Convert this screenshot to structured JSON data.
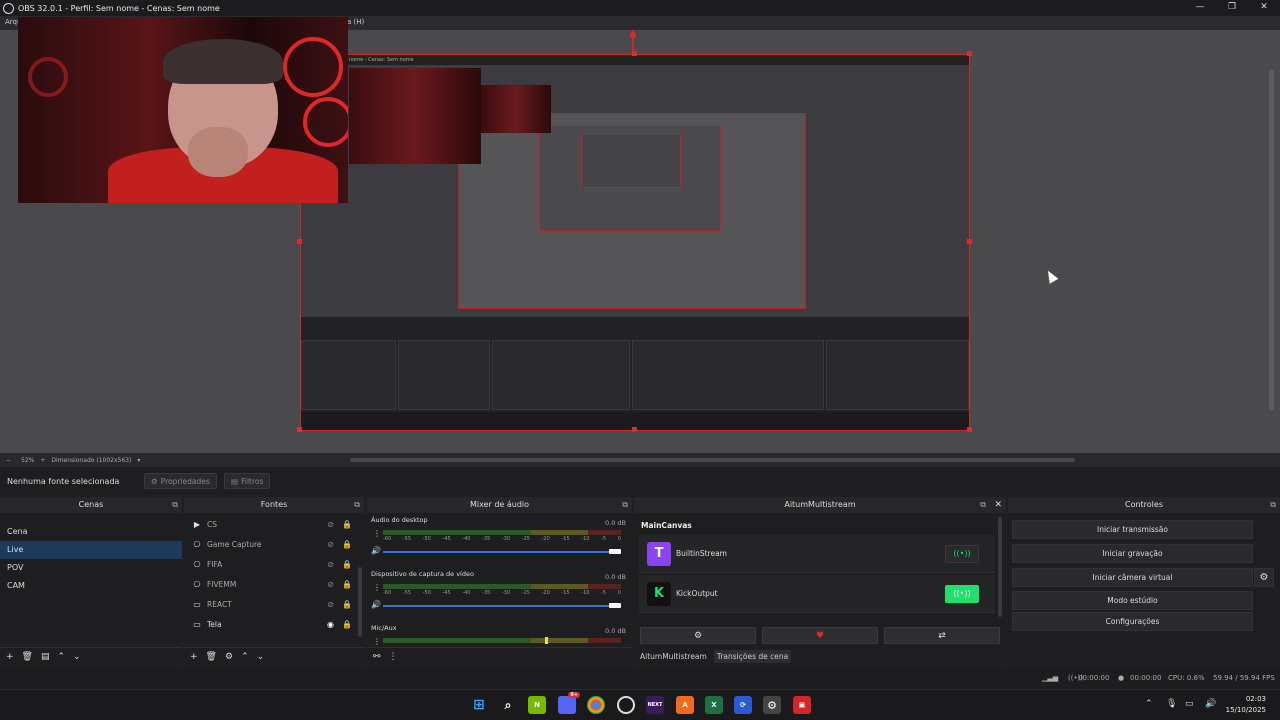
{
  "window": {
    "title": "OBS 32.0.1 - Perfil: Sem nome - Cenas: Sem nome",
    "minimize": "—",
    "maximize": "❐",
    "close": "✕"
  },
  "menubar": {
    "left_fragment": "Arqu",
    "right_fragment": "a (H)"
  },
  "preview": {
    "inner_title": "nome - Cenas: Sem nome"
  },
  "zoombar": {
    "minus": "−",
    "zoom": "52%",
    "plus": "+",
    "mode": "Dimensionado (1002x563)",
    "dropdown": "▾"
  },
  "sourcebar": {
    "no_source": "Nenhuma fonte selecionada",
    "properties": "Propriedades",
    "filters": "Filtros"
  },
  "scenes": {
    "header": "Cenas",
    "items": [
      "Cena",
      "Live",
      "POV",
      "CAM"
    ],
    "selected": "Live"
  },
  "sources": {
    "header": "Fontes",
    "items": [
      {
        "label": "CS",
        "icon": "play-icon"
      },
      {
        "label": "Game Capture",
        "icon": "gamepad-icon"
      },
      {
        "label": "FIFA",
        "icon": "gamepad-icon"
      },
      {
        "label": "FIVEMM",
        "icon": "gamepad-icon"
      },
      {
        "label": "REACT",
        "icon": "window-icon"
      },
      {
        "label": "Tela",
        "icon": "monitor-icon"
      }
    ]
  },
  "mixer": {
    "header": "Mixer de áudio",
    "channels": [
      {
        "name": "Áudio do desktop",
        "db": "0.0 dB"
      },
      {
        "name": "Dispositivo de captura de vídeo",
        "db": "0.0 dB"
      },
      {
        "name": "Mic/Aux",
        "db": "0.0 dB"
      }
    ],
    "scale": [
      "-60",
      "-55",
      "-50",
      "-45",
      "-40",
      "-35",
      "-30",
      "-25",
      "-20",
      "-15",
      "-10",
      "-5",
      "0"
    ]
  },
  "multistream": {
    "header": "AitumMultistream",
    "canvas": "MainCanvas",
    "outputs": [
      {
        "label": "BuiltinStream",
        "logo": "T",
        "logo_color": "#8b44f0",
        "active": false
      },
      {
        "label": "KickOutput",
        "logo": "K",
        "logo_color": "#111111",
        "active": true
      }
    ],
    "tabs": [
      "AitumMultistream",
      "Transições de cena"
    ]
  },
  "controls": {
    "header": "Controles",
    "buttons": [
      "Iniciar transmissão",
      "Iniciar gravação",
      "Iniciar câmera virtual",
      "Modo estúdio",
      "Configurações"
    ]
  },
  "status": {
    "stream_time": "00:00:00",
    "rec_time": "00:00:00",
    "cpu": "CPU: 0.6%",
    "fps": "59.94 / 59.94 FPS"
  },
  "taskbar": {
    "time": "02:03",
    "date": "15/10/2025",
    "discord_badge": "9+",
    "next_label": "NEXT"
  },
  "colors": {
    "accent_red": "#d3262b",
    "selection_blue": "#1e3a5a",
    "kick_green": "#1ee06a",
    "twitch_purple": "#8b44f0"
  }
}
